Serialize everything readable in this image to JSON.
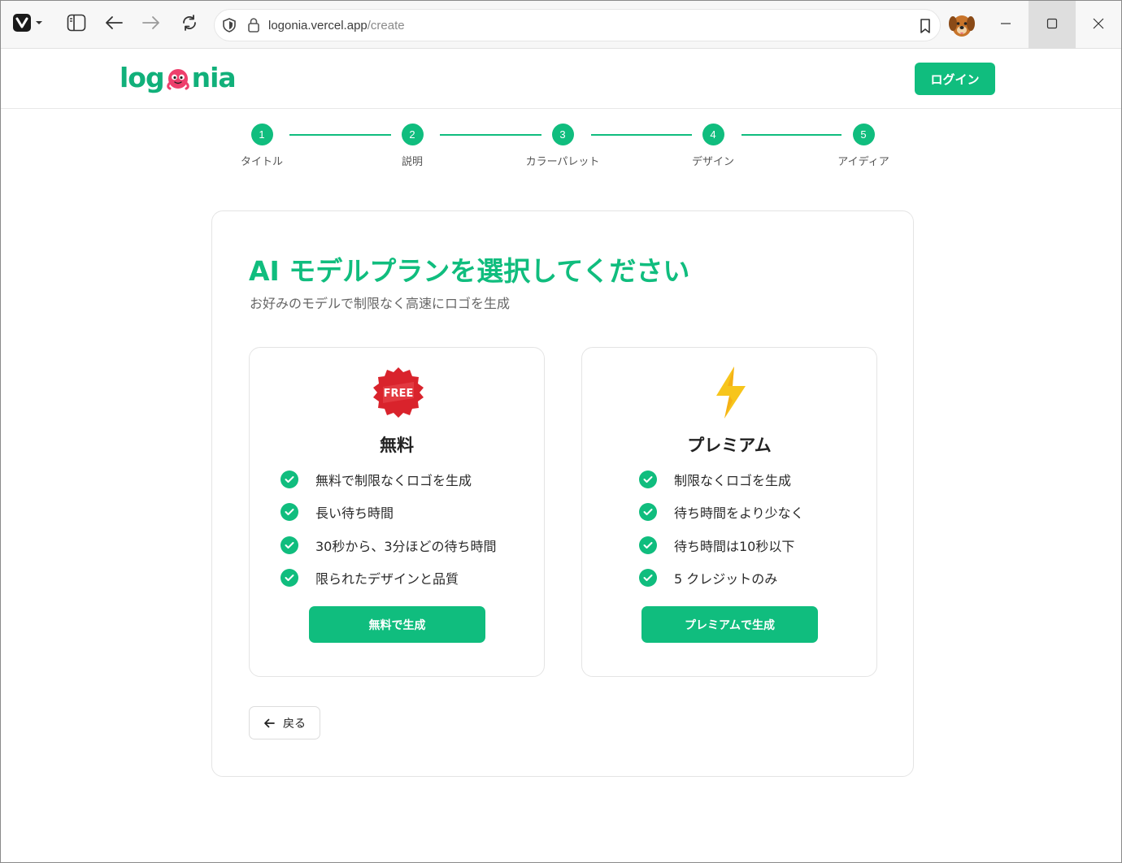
{
  "browser": {
    "url_host": "logonia.vercel.app",
    "url_path": "/create",
    "icons": [
      "vivaldi-icon",
      "sidebar-icon",
      "back-icon",
      "forward-icon",
      "reload-icon",
      "shield-icon",
      "lock-icon",
      "bookmark-icon",
      "profile-avatar",
      "minimize-icon",
      "maximize-icon",
      "close-icon"
    ]
  },
  "header": {
    "logo_left": "log",
    "logo_right": "nia",
    "login_label": "ログイン"
  },
  "steps": [
    {
      "num": "1",
      "label": "タイトル"
    },
    {
      "num": "2",
      "label": "説明"
    },
    {
      "num": "3",
      "label": "カラーパレット"
    },
    {
      "num": "4",
      "label": "デザイン"
    },
    {
      "num": "5",
      "label": "アイディア"
    }
  ],
  "main": {
    "title": "AI モデルプランを選択してください",
    "subtitle": "お好みのモデルで制限なく高速にロゴを生成",
    "back_label": "戻る"
  },
  "plans": {
    "free": {
      "badge_text": "FREE",
      "name": "無料",
      "features": [
        "無料で制限なくロゴを生成",
        "長い待ち時間",
        "30秒から、3分ほどの待ち時間",
        "限られたデザインと品質"
      ],
      "button_label": "無料で生成"
    },
    "premium": {
      "name": "プレミアム",
      "features": [
        "制限なくロゴを生成",
        "待ち時間をより少なく",
        "待ち時間は10秒以下",
        "5 クレジットのみ"
      ],
      "button_label": "プレミアムで生成"
    }
  },
  "colors": {
    "accent": "#10bd7e",
    "badge_red": "#d9232c",
    "lightning": "#f7c51b"
  }
}
